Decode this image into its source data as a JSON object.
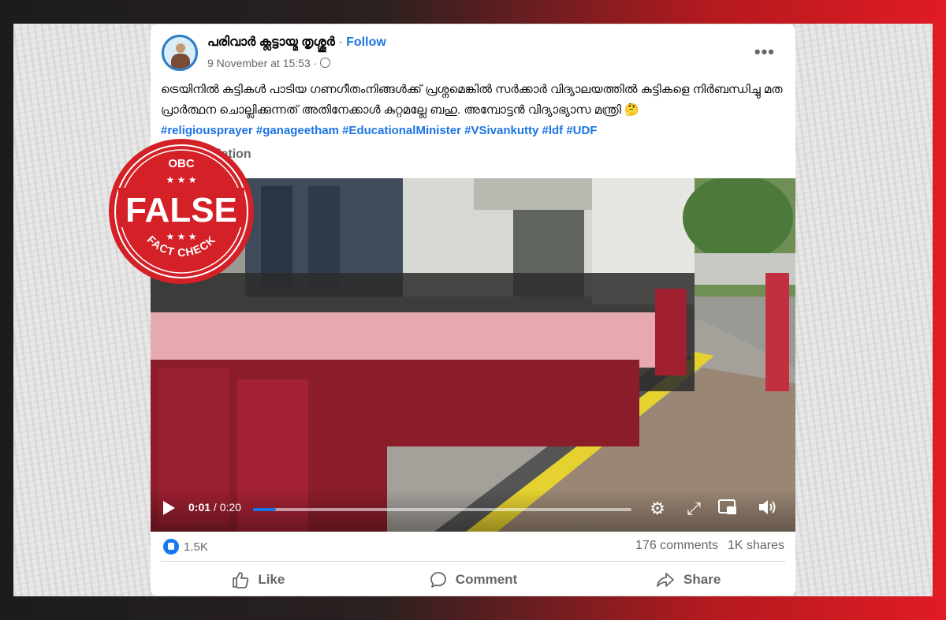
{
  "post": {
    "author": "പരിവാർ ക്ലട്ടായ്മ തൃശ്ശൂർ",
    "separator": "·",
    "follow_label": "Follow",
    "timestamp": "9 November at 15:53 ·",
    "text": "ട്രെയിനിൽ കുട്ടികൾ പാടിയ ഗണഗീതംനിങ്ങൾക്ക് പ്രശ്നമെങ്കിൽ സർക്കാർ വിദ്യാലയത്തിൽ കുട്ടികളെ നിർബന്ധിച്ചു മത പ്രാർത്ഥന ചൊല്ലിക്കുന്നത് അതിനേക്കാൾ കുറ്റമല്ലേ ബഹു. അമ്പോട്ടൻ വിദ്യാഭ്യാസ മന്ത്രി 🤔",
    "hashtags": "#religiousprayer #ganageetham #EducationalMinister #VSivankutty #ldf #UDF",
    "translation_label": "See translation",
    "more_label": "•••"
  },
  "video": {
    "current_time": "0:01",
    "separator": " / ",
    "duration": "0:20",
    "progress_fraction": 0.06
  },
  "stats": {
    "likes": "1.5K",
    "comments": "176 comments",
    "shares": "1K shares"
  },
  "actions": {
    "like": "Like",
    "comment": "Comment",
    "share": "Share"
  },
  "stamp": {
    "badge": "OBC",
    "label": "FALSE",
    "sublabel": "FACT CHECK",
    "color": "#d42027"
  },
  "colors": {
    "link": "#1b74e4",
    "muted": "#65676b",
    "stamp_red": "#d42027"
  }
}
